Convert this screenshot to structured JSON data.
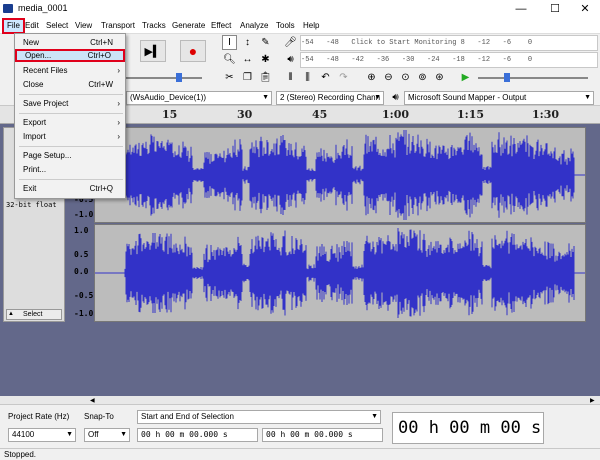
{
  "window": {
    "title": "media_0001",
    "minimize": "—",
    "maximize": "☐",
    "close": "✕"
  },
  "menubar": [
    "File",
    "Edit",
    "Select",
    "View",
    "Transport",
    "Tracks",
    "Generate",
    "Effect",
    "Analyze",
    "Tools",
    "Help"
  ],
  "file_menu": {
    "items": [
      {
        "label": "New",
        "shortcut": "Ctrl+N"
      },
      {
        "label": "Open...",
        "shortcut": "Ctrl+O"
      },
      {
        "label": "Recent Files",
        "shortcut": "›"
      },
      {
        "label": "Close",
        "shortcut": "Ctrl+W"
      },
      {
        "label": "Save Project",
        "shortcut": "›"
      },
      {
        "label": "Export",
        "shortcut": "›"
      },
      {
        "label": "Import",
        "shortcut": "›"
      },
      {
        "label": "Page Setup...",
        "shortcut": ""
      },
      {
        "label": "Print...",
        "shortcut": ""
      },
      {
        "label": "Exit",
        "shortcut": "Ctrl+Q"
      }
    ]
  },
  "meter": {
    "top": "-54   -48   Click to Start Monitoring 8   -12   -6    0",
    "bottom": "-54   -48   -42   -36   -30   -24   -18   -12   -6    0"
  },
  "devices": {
    "host": "(WsAudio_Device(1))",
    "channels": "2 (Stereo) Recording Chann",
    "output": "Microsoft Sound Mapper - Output"
  },
  "ruler": [
    "15",
    "30",
    "45",
    "1:00",
    "1:15",
    "1:30"
  ],
  "track": {
    "format": "32-bit float",
    "select_label": "Select",
    "scale_top": [
      "-0.5",
      "-1.0"
    ],
    "scale_bottom": [
      "1.0",
      "0.5",
      "0.0",
      "-0.5",
      "-1.0"
    ]
  },
  "selection_bar": {
    "project_rate_label": "Project Rate (Hz)",
    "snap_label": "Snap-To",
    "project_rate": "44100",
    "snap": "Off",
    "selection_mode": "Start and End of Selection",
    "start": "00 h 00 m 00.000 s",
    "end": "00 h 00 m 00.000 s",
    "audio_position": "00 h 00 m 00 s"
  },
  "status": "Stopped.",
  "colors": {
    "waveform": "#3232c8",
    "highlight": "#e0001b",
    "menu_hover": "#cce4f7"
  }
}
